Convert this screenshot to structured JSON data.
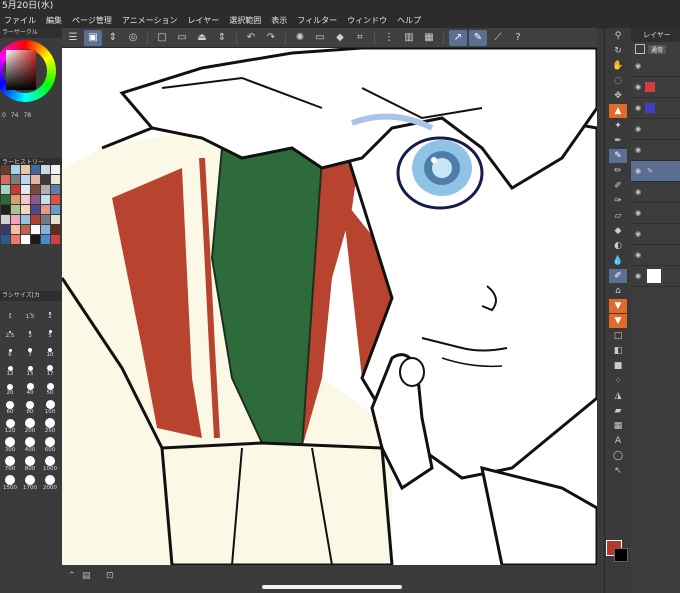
{
  "status": {
    "date": "5月20日(水)"
  },
  "menu": [
    "ファイル",
    "編集",
    "ページ管理",
    "アニメーション",
    "レイヤー",
    "選択範囲",
    "表示",
    "フィルター",
    "ウィンドウ",
    "ヘルプ"
  ],
  "panels": {
    "color_circle": "ラーサークル",
    "color_history": "ラーヒストリー",
    "brush_size": "ラシサイズ[カ"
  },
  "hsv": {
    "h": "0",
    "s": "74",
    "v": "78"
  },
  "brush_sizes": [
    "1",
    "1.5",
    "2",
    "2.5",
    "3",
    "5",
    "6",
    "7",
    "10",
    "12",
    "15",
    "17",
    "20",
    "40",
    "50",
    "60",
    "80",
    "100",
    "120",
    "200",
    "250",
    "300",
    "400",
    "600",
    "700",
    "800",
    "1000",
    "1500",
    "1700",
    "2000"
  ],
  "layer_panel": {
    "title": "レイヤー",
    "blend_mode": "通常"
  },
  "colors": {
    "main_color": "#b8382a",
    "sub_color": "#000000",
    "accent": "#5a6f92",
    "scarf_red": "#b8432f",
    "scarf_green": "#2e6b3a",
    "cream": "#fbf8e6",
    "eye_blue": "#8fc3e6"
  },
  "icons": {
    "toolbar": [
      "menu-icon",
      "canvas-icon",
      "arrows-icon",
      "layer-view-icon",
      "new-icon",
      "open-icon",
      "save-icon",
      "export-icon",
      "undo-icon",
      "redo-icon",
      "loading-icon",
      "clear-icon",
      "fill-icon",
      "crop-icon",
      "snap-icon",
      "ruler-icon",
      "pen-icon",
      "help-icon"
    ],
    "tools": [
      "zoom-icon",
      "rotate-icon",
      "hand-icon",
      "lasso-icon",
      "move-icon",
      "marker-icon",
      "magic-wand-icon",
      "eyedropper-icon",
      "pen-tool-icon",
      "pencil-icon",
      "brush-icon",
      "airbrush-icon",
      "eraser-icon",
      "blend-icon",
      "fill-tool-icon",
      "gradient-icon",
      "text-icon",
      "balloon-icon",
      "select-icon"
    ]
  }
}
